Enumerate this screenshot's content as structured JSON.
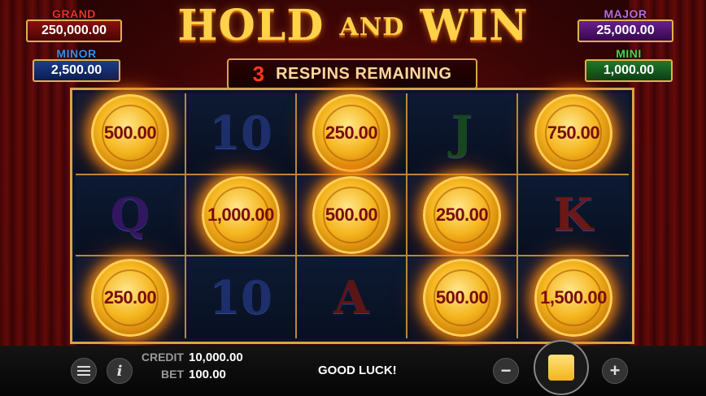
{
  "title": {
    "main_left": "HOLD",
    "main_mid": "AND",
    "main_right": "WIN"
  },
  "jackpots": {
    "grand": {
      "label": "GRAND",
      "value": "250,000.00"
    },
    "minor": {
      "label": "MINOR",
      "value": "2,500.00"
    },
    "major": {
      "label": "MAJOR",
      "value": "25,000.00"
    },
    "mini": {
      "label": "MINI",
      "value": "1,000.00"
    }
  },
  "respins": {
    "count": "3",
    "text": "RESPINS REMAINING"
  },
  "grid": {
    "rows": [
      [
        {
          "type": "coin",
          "value": "500.00"
        },
        {
          "type": "symbol",
          "value": "10",
          "icon": "ten-symbol"
        },
        {
          "type": "coin",
          "value": "250.00"
        },
        {
          "type": "symbol",
          "value": "J",
          "icon": "jack-symbol"
        },
        {
          "type": "coin",
          "value": "750.00"
        }
      ],
      [
        {
          "type": "symbol",
          "value": "Q",
          "icon": "queen-symbol"
        },
        {
          "type": "coin",
          "value": "1,000.00"
        },
        {
          "type": "coin",
          "value": "500.00"
        },
        {
          "type": "coin",
          "value": "250.00"
        },
        {
          "type": "symbol",
          "value": "K",
          "icon": "king-symbol"
        }
      ],
      [
        {
          "type": "coin",
          "value": "250.00"
        },
        {
          "type": "symbol",
          "value": "10",
          "icon": "ten-symbol"
        },
        {
          "type": "symbol",
          "value": "A",
          "icon": "ace-symbol"
        },
        {
          "type": "coin",
          "value": "500.00"
        },
        {
          "type": "coin",
          "value": "1,500.00"
        }
      ]
    ]
  },
  "bottom_bar": {
    "credit_label": "CREDIT",
    "credit_value": "10,000.00",
    "bet_label": "BET",
    "bet_value": "100.00",
    "message": "GOOD LUCK!",
    "menu_icon": "hamburger-menu-icon",
    "info_icon": "info-icon",
    "info_glyph": "i",
    "minus_glyph": "−",
    "plus_glyph": "+"
  }
}
